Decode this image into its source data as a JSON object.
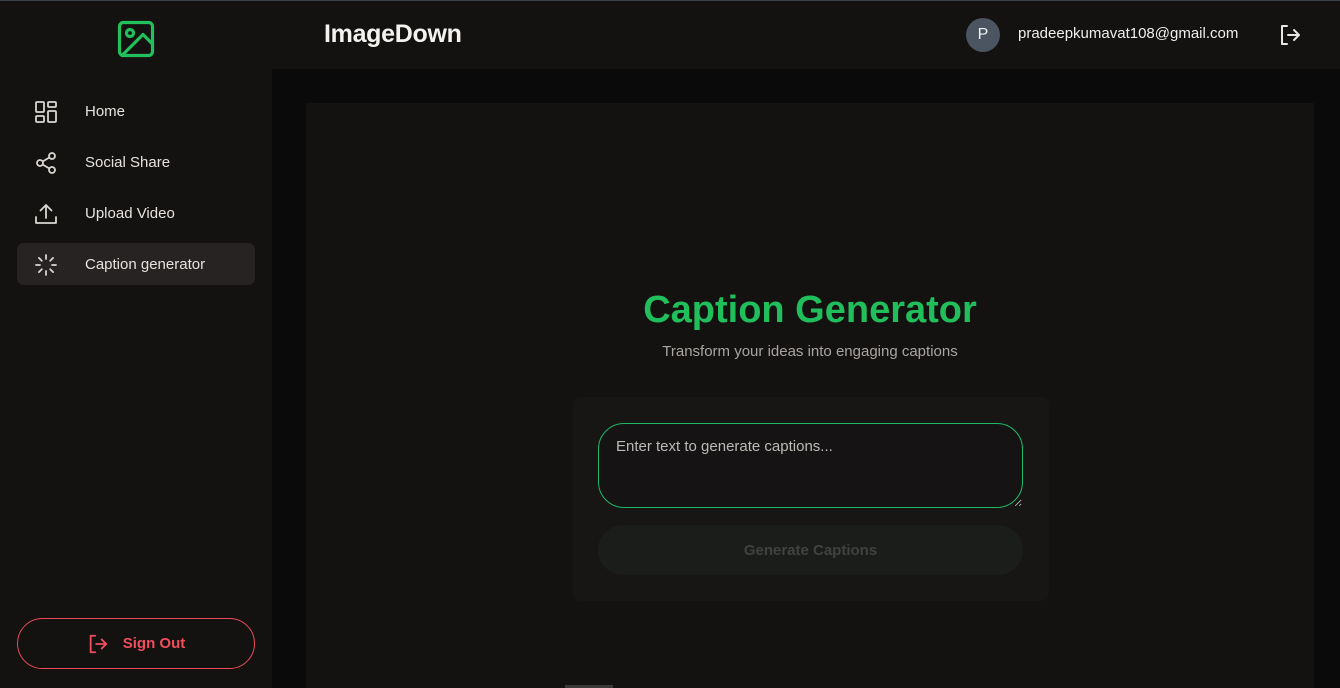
{
  "app": {
    "title": "ImageDown"
  },
  "user": {
    "avatar_initial": "P",
    "email": "pradeepkumavat108@gmail.com"
  },
  "sidebar": {
    "items": [
      {
        "label": "Home",
        "icon": "grid-icon",
        "active": false
      },
      {
        "label": "Social Share",
        "icon": "share-icon",
        "active": false
      },
      {
        "label": "Upload Video",
        "icon": "upload-icon",
        "active": false
      },
      {
        "label": "Caption generator",
        "icon": "loader-icon",
        "active": true
      }
    ],
    "signout_label": "Sign Out"
  },
  "main": {
    "title": "Caption Generator",
    "subtitle": "Transform your ideas into engaging captions",
    "input_placeholder": "Enter text to generate captions...",
    "input_value": "",
    "generate_label": "Generate Captions"
  },
  "colors": {
    "brand_green": "#21bf5b",
    "signout_red": "#f04d5e",
    "background": "#0b0a0a",
    "panel": "#141111"
  }
}
